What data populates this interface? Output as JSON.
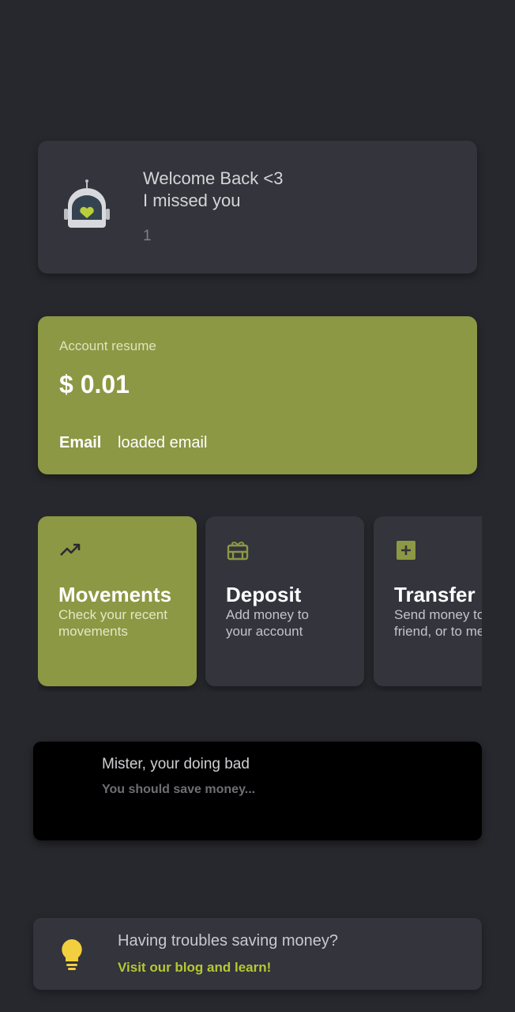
{
  "welcome": {
    "line1": "Welcome Back <3",
    "line2": "I missed you",
    "count": "1",
    "avatar_icon": "robot-heart-icon"
  },
  "account": {
    "label": "Account resume",
    "balance": "$ 0.01",
    "email_label": "Email",
    "email_value": "loaded email"
  },
  "actions": [
    {
      "title": "Movements",
      "description": "Check your recent movements",
      "icon": "trending-up-icon",
      "active": true
    },
    {
      "title": "Deposit",
      "description": "Add money to your account",
      "icon": "card-giftcard-icon",
      "active": false
    },
    {
      "title": "Transfer",
      "description_line1": "Send money to a",
      "description_line2": "friend, or to me",
      "icon": "add-box-icon",
      "active": false
    }
  ],
  "warning": {
    "title": "Mister, your doing bad",
    "subtitle": "You should save money..."
  },
  "tip": {
    "title": "Having troubles saving money?",
    "link": "Visit our blog and learn!",
    "icon": "lightbulb-icon"
  },
  "colors": {
    "background": "#27282d",
    "card": "#33343c",
    "accent": "#8c9843",
    "link": "#b6c832",
    "bulb": "#f2cf3e"
  }
}
